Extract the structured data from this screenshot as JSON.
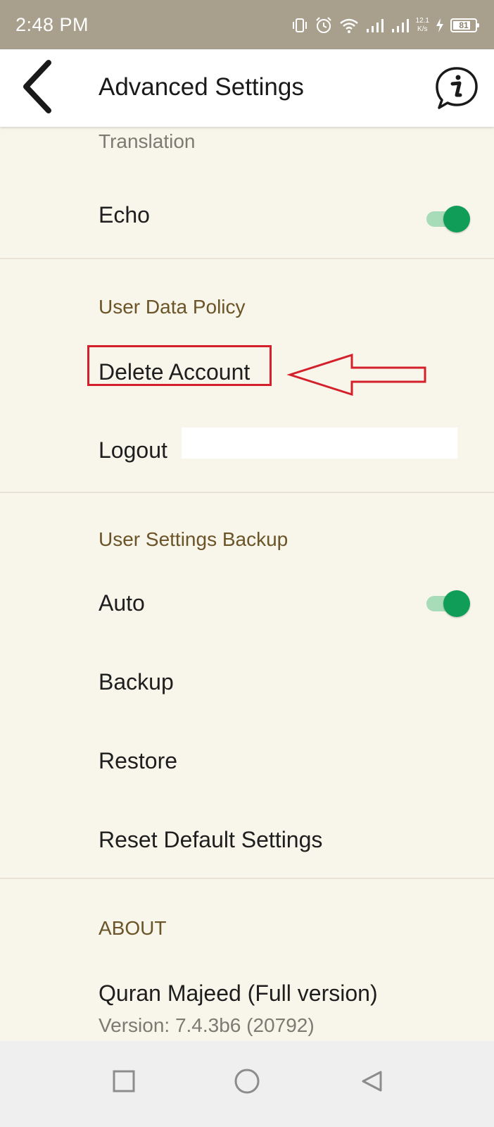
{
  "status_bar": {
    "time": "2:48 PM",
    "net_speed_value": "12.1",
    "net_speed_unit": "K/s",
    "battery_level": "81",
    "battery_percent": 81,
    "icons": [
      "vibrate-icon",
      "alarm-icon",
      "wifi-icon",
      "signal-icon",
      "signal-icon",
      "charging-icon",
      "battery-icon"
    ]
  },
  "app_bar": {
    "back_icon": "back-arrow-icon",
    "title": "Advanced Settings",
    "info_icon": "info-bubble-icon"
  },
  "sections": {
    "top_partial": {
      "translation_label": "Translation",
      "echo_label": "Echo",
      "echo_enabled": true
    },
    "user_data_policy": {
      "header": "User Data Policy",
      "delete_account_label": "Delete Account",
      "logout_label": "Logout"
    },
    "user_settings_backup": {
      "header": "User Settings Backup",
      "auto_label": "Auto",
      "auto_enabled": true,
      "backup_label": "Backup",
      "restore_label": "Restore",
      "reset_label": "Reset Default Settings"
    },
    "about": {
      "header": "ABOUT",
      "app_name": "Quran Majeed (Full version)",
      "version": "Version: 7.4.3b6 (20792)"
    }
  },
  "annotation": {
    "color": "#d4202a",
    "target": "Delete Account"
  },
  "nav_bar": {
    "recents_icon": "square-icon",
    "home_icon": "circle-icon",
    "back_icon": "triangle-back-icon"
  },
  "colors": {
    "background": "#f8f5ea",
    "status_bar": "#a89f8c",
    "section_header": "#6a5428",
    "toggle_on": "#0f9d58",
    "toggle_track": "#a8dcb8"
  }
}
